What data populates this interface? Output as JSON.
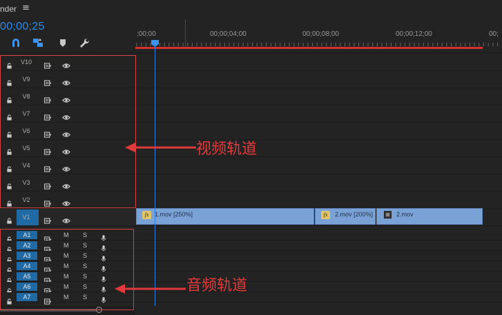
{
  "sequence": {
    "name": "nder",
    "menu_icon": "hamburger-icon",
    "timecode": "00;00;25"
  },
  "toolbar": {
    "tools": [
      "snap-magnet-icon",
      "linked-selection-icon",
      "add-marker-icon",
      "wrench-settings-icon"
    ]
  },
  "ruler": {
    "labels": [
      ";00;00",
      "00;00;04;00",
      "00;00;08;00",
      "00;00;12;00",
      "00;"
    ]
  },
  "video_tracks": [
    {
      "name": "V10"
    },
    {
      "name": "V9"
    },
    {
      "name": "V8"
    },
    {
      "name": "V7"
    },
    {
      "name": "V6"
    },
    {
      "name": "V5"
    },
    {
      "name": "V4"
    },
    {
      "name": "V3"
    },
    {
      "name": "V2"
    },
    {
      "name": "V1"
    }
  ],
  "audio_tracks": [
    {
      "name": "A1"
    },
    {
      "name": "A2"
    },
    {
      "name": "A3"
    },
    {
      "name": "A4"
    },
    {
      "name": "A5"
    },
    {
      "name": "A6"
    },
    {
      "name": "A7"
    }
  ],
  "audio_buttons": {
    "mute": "M",
    "solo": "S"
  },
  "clips": [
    {
      "label": "1.mov [250%]",
      "badge": "fx"
    },
    {
      "label": "2.mov [200%]",
      "badge": "fx"
    },
    {
      "label": "2.mov",
      "badge": ""
    }
  ],
  "annotations": {
    "video": "视频轨道",
    "audio": "音频轨道"
  },
  "colors": {
    "accent_blue": "#2d8ceb",
    "annotation_red": "#e23a3a",
    "clip_blue": "#7aa2d6",
    "patch_blue": "#1f6aa5"
  }
}
